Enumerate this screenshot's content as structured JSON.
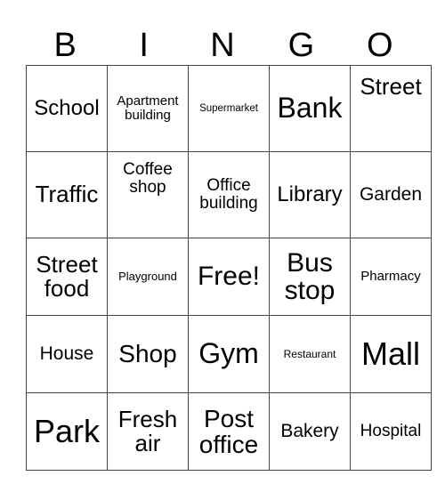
{
  "header": [
    "B",
    "I",
    "N",
    "G",
    "O"
  ],
  "rows": [
    [
      "School",
      "Apartment building",
      "Supermarket",
      "Bank",
      "Street"
    ],
    [
      "Traffic",
      "Coffee shop",
      "Office building",
      "Library",
      "Garden"
    ],
    [
      "Street food",
      "Playground",
      "Free!",
      "Bus stop",
      "Pharmacy"
    ],
    [
      "House",
      "Shop",
      "Gym",
      "Restaurant",
      "Mall"
    ],
    [
      "Park",
      "Fresh air",
      "Post office",
      "Bakery",
      "Hospital"
    ]
  ]
}
